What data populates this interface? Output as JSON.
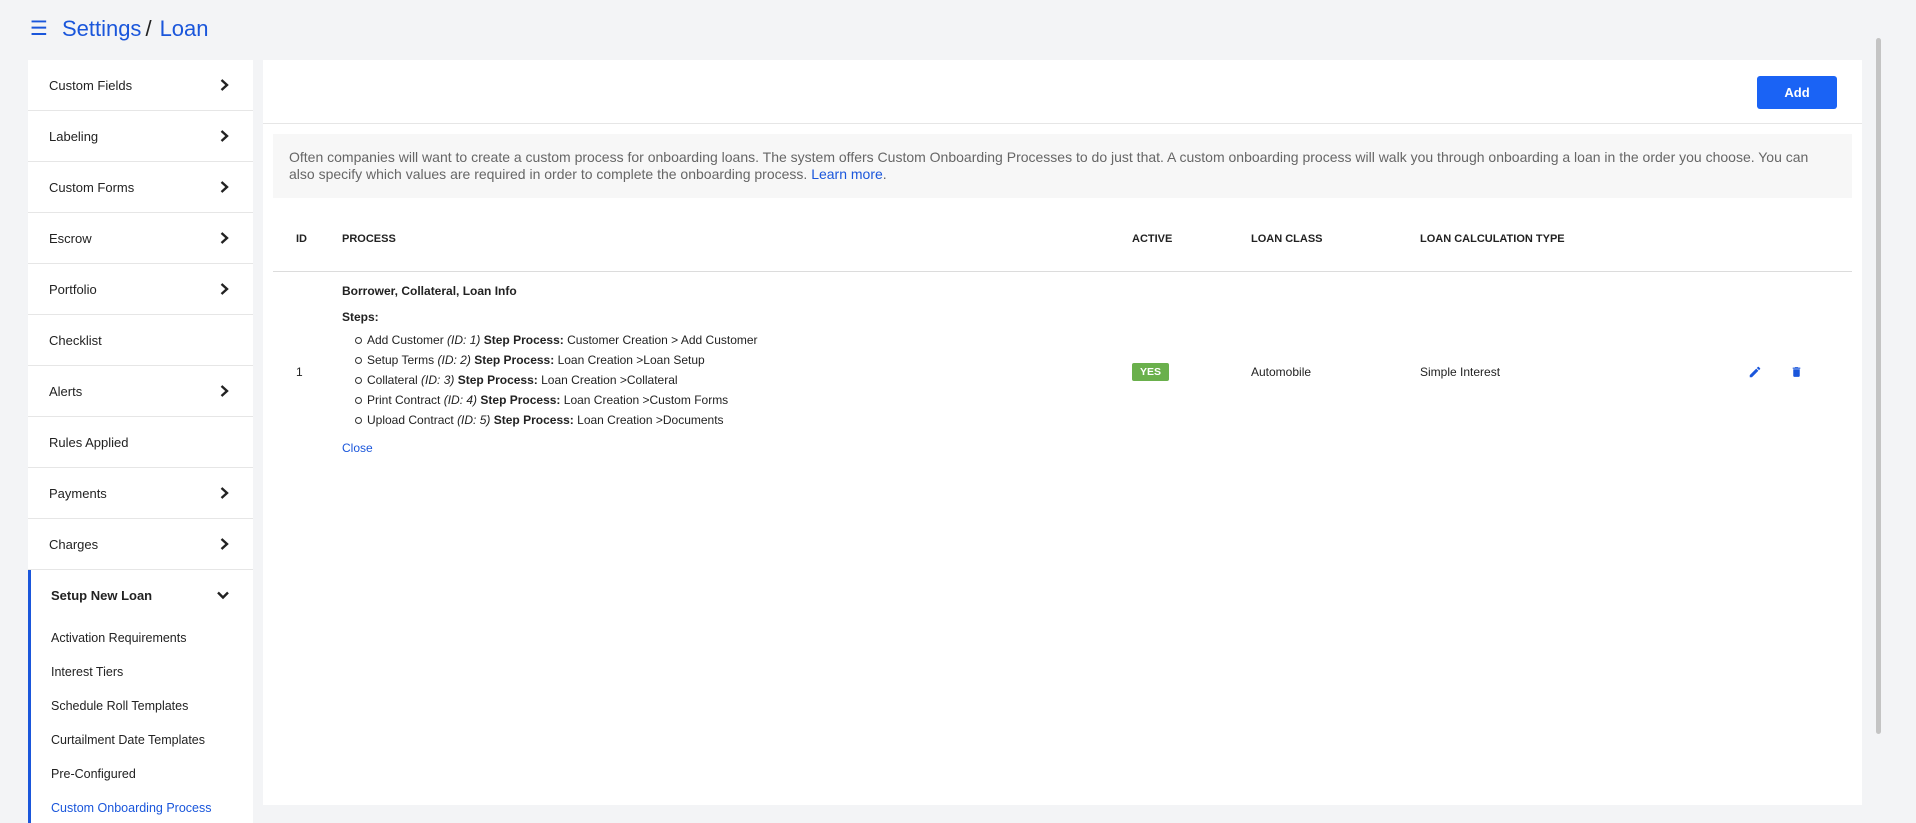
{
  "breadcrumb": {
    "root": "Settings",
    "separator": "/",
    "current": "Loan"
  },
  "sidebar": {
    "items": [
      {
        "label": "Custom Fields",
        "has_arrow": true
      },
      {
        "label": "Labeling",
        "has_arrow": true
      },
      {
        "label": "Custom Forms",
        "has_arrow": true
      },
      {
        "label": "Escrow",
        "has_arrow": true
      },
      {
        "label": "Portfolio",
        "has_arrow": true
      },
      {
        "label": "Checklist",
        "has_arrow": false
      },
      {
        "label": "Alerts",
        "has_arrow": true
      },
      {
        "label": "Rules Applied",
        "has_arrow": false
      },
      {
        "label": "Payments",
        "has_arrow": true
      },
      {
        "label": "Charges",
        "has_arrow": true
      }
    ],
    "expanded_group": {
      "label": "Setup New Loan",
      "sub_items": [
        "Activation Requirements",
        "Interest Tiers",
        "Schedule Roll Templates",
        "Curtailment Date Templates",
        "Pre-Configured",
        "Custom Onboarding Process"
      ],
      "active_sub_item": "Custom Onboarding Process"
    }
  },
  "toolbar": {
    "add_label": "Add"
  },
  "info": {
    "text": "Often companies will want to create a custom process for onboarding loans. The system offers Custom Onboarding Processes to do just that. A custom onboarding process will walk you through onboarding a loan in the order you choose. You can also specify which values are required in order to complete the onboarding process. ",
    "link": "Learn more",
    "trail": "."
  },
  "table": {
    "headers": {
      "id": "ID",
      "process": "PROCESS",
      "active": "ACTIVE",
      "loan_class": "LOAN CLASS",
      "calc_type": "LOAN CALCULATION TYPE"
    },
    "rows": [
      {
        "id": "1",
        "process_title": "Borrower, Collateral, Loan Info",
        "steps_label": "Steps:",
        "steps": [
          {
            "name": "Add Customer",
            "id_text": "(ID: 1)",
            "process_label": "Step Process:",
            "process": "Customer Creation > Add Customer"
          },
          {
            "name": "Setup Terms",
            "id_text": "(ID: 2)",
            "process_label": "Step Process:",
            "process": "Loan Creation >Loan Setup"
          },
          {
            "name": "Collateral",
            "id_text": "(ID: 3)",
            "process_label": "Step Process:",
            "process": "Loan Creation >Collateral"
          },
          {
            "name": "Print Contract",
            "id_text": "(ID: 4)",
            "process_label": "Step Process:",
            "process": "Loan Creation >Custom Forms"
          },
          {
            "name": "Upload Contract",
            "id_text": "(ID: 5)",
            "process_label": "Step Process:",
            "process": "Loan Creation >Documents"
          }
        ],
        "close_label": "Close",
        "active": "YES",
        "loan_class": "Automobile",
        "calc_type": "Simple Interest"
      }
    ]
  },
  "colors": {
    "accent": "#1a56db",
    "button": "#1a63f5",
    "active_badge": "#6ab04c"
  },
  "icons": {
    "menu": "hamburger-icon",
    "edit": "pencil-icon",
    "delete": "trash-icon",
    "expand": "chevron-right-icon",
    "collapse": "chevron-down-icon"
  }
}
